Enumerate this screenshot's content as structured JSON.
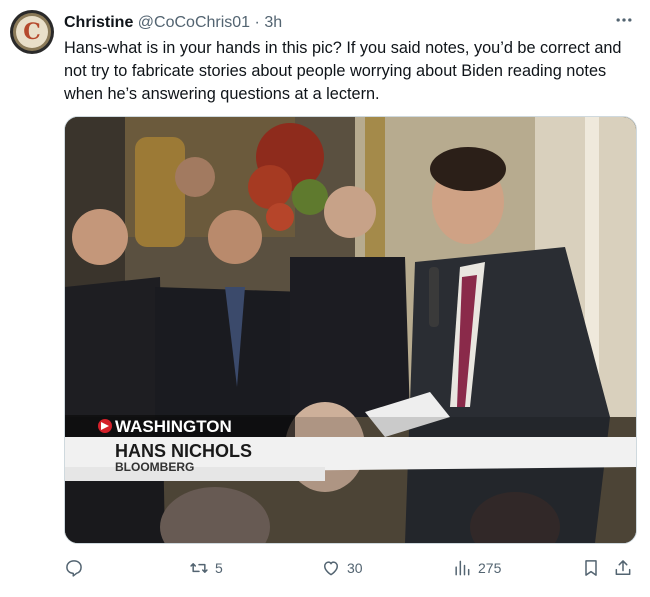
{
  "tweet": {
    "author_name": "Christine",
    "handle": "@CoCoChris01",
    "separator": "·",
    "time": "3h",
    "avatar_letter": "C",
    "text": "Hans-what is in your hands in this pic? If you said notes, you’d be correct and not try to fabricate stories about people worrying about Biden reading notes when he’s answering questions at a lectern.",
    "media": {
      "lower_third": {
        "location": "WASHINGTON",
        "name": "HANS NICHOLS",
        "affiliation": "BLOOMBERG"
      }
    },
    "actions": {
      "reply_count": "",
      "retweet_count": "5",
      "like_count": "30",
      "views_count": "275"
    }
  },
  "colors": {
    "text_primary": "#0f1419",
    "text_secondary": "#536471",
    "border": "#cfd9de",
    "banner_red": "#d4202a"
  },
  "icons": [
    "more-icon",
    "reply-icon",
    "retweet-icon",
    "like-icon",
    "views-icon",
    "bookmark-icon",
    "share-icon"
  ]
}
